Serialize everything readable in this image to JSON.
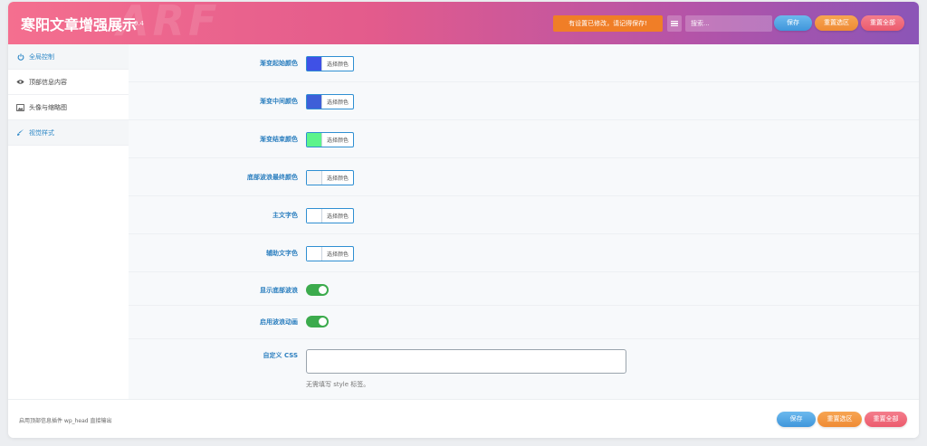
{
  "header": {
    "title": "寒阳文章增强展示",
    "version": "v1.0.4",
    "watermark": "ARF",
    "notice": "有设置已修改，请记得保存!",
    "search_placeholder": "搜索...",
    "save_label": "保存",
    "reset_section_label": "重置选区",
    "reset_all_label": "重置全部"
  },
  "sidebar": {
    "items": [
      {
        "label": "全局控制",
        "icon": "power-icon",
        "active": true
      },
      {
        "label": "顶部信息内容",
        "icon": "eye-icon",
        "active": false
      },
      {
        "label": "头像与缩略图",
        "icon": "image-icon",
        "active": false
      },
      {
        "label": "视觉样式",
        "icon": "brush-icon",
        "active": true
      }
    ]
  },
  "fields": {
    "gradient_start": {
      "label": "渐变起始颜色",
      "button": "选择颜色",
      "color": "#3f51e6"
    },
    "gradient_middle": {
      "label": "渐变中间颜色",
      "button": "选择颜色",
      "color": "#3e5fd8"
    },
    "gradient_end": {
      "label": "渐变结束颜色",
      "button": "选择颜色",
      "color": "#5cf48b"
    },
    "wave_final": {
      "label": "底部波浪最终颜色",
      "button": "选择颜色",
      "color": "#f5f6f7"
    },
    "main_text": {
      "label": "主文字色",
      "button": "选择颜色",
      "color": "#ffffff"
    },
    "sub_text": {
      "label": "辅助文字色",
      "button": "选择颜色",
      "color": "#ffffff"
    },
    "show_wave": {
      "label": "显示底部波浪",
      "on": true
    },
    "wave_anim": {
      "label": "启用波浪动画",
      "on": true
    },
    "custom_css": {
      "label": "自定义 CSS",
      "value": "",
      "hint": "无需填写 style 标签。"
    }
  },
  "footer": {
    "note": "启用顶部信息插件 wp_head 直接输出",
    "save_label": "保存",
    "reset_section_label": "重置选区",
    "reset_all_label": "重置全部"
  },
  "colors": {
    "accent": "#2c7fbf",
    "toggle_on": "#3cab4d",
    "notice_bg": "#f07e27"
  }
}
